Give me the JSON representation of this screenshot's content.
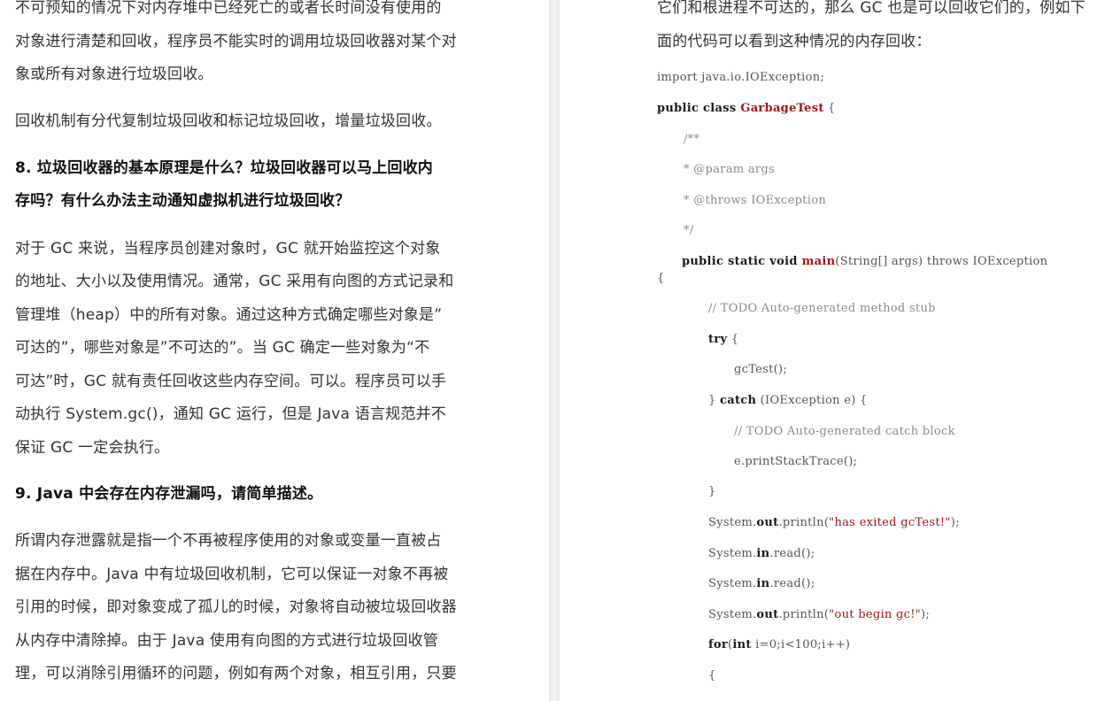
{
  "left_page": {
    "lines": [
      {
        "text": "不可预知的情况下对内存堆中已经死亡的或者长时间没有使用的",
        "style": "body"
      },
      {
        "text": "对象进行清楚和回收，程序员不能实时的调用垃圾回收器对某个对",
        "style": "body"
      },
      {
        "text": "象或所有对象进行垃圾回收。",
        "style": "body"
      },
      {
        "text": "回收机制有分代复制垃圾回收和标记垃圾回收，增量垃圾回收。",
        "style": "body"
      },
      {
        "text": "8.  垃圾回收器的基本原理是什么？垃圾回收器可以马上回收内",
        "style": "head"
      },
      {
        "text": "存吗？有什么办法主动通知虚拟机进行垃圾回收？",
        "style": "head"
      },
      {
        "text": "对于  GC  来说，当程序员创建对象时，GC  就开始监控这个对象",
        "style": "body"
      },
      {
        "text": "的地址、大小以及使用情况。通常，GC  采用有向图的方式记录和",
        "style": "body"
      },
      {
        "text": "管理堆（heap）中的所有对象。通过这种方式确定哪些对象是”",
        "style": "body"
      },
      {
        "text": "可达的”，哪些对象是”不可达的”。当  GC  确定一些对象为“不",
        "style": "body"
      },
      {
        "text": "可达”时，GC  就有责任回收这些内存空间。可以。程序员可以手",
        "style": "body"
      },
      {
        "text": "动执行  System.gc()，通知  GC  运行，但是  Java  语言规范并不",
        "style": "body"
      },
      {
        "text": "保证  GC  一定会执行。",
        "style": "body"
      },
      {
        "text": "9. Java  中会存在内存泄漏吗，请简单描述。",
        "style": "head"
      },
      {
        "text": "所谓内存泄露就是指一个不再被程序使用的对象或变量一直被占",
        "style": "body"
      },
      {
        "text": "据在内存中。Java  中有垃圾回收机制，它可以保证一对象不再被",
        "style": "body"
      },
      {
        "text": "引用的时候，即对象变成了孤儿的时候，对象将自动被垃圾回收器",
        "style": "body"
      },
      {
        "text": "从内存中清除掉。由于  Java  使用有向图的方式进行垃圾回收管",
        "style": "body"
      },
      {
        "text": "理，可以消除引用循环的问题，例如有两个对象，相互引用，只要",
        "style": "body"
      }
    ]
  },
  "right_page": {
    "intro": [
      "它们和根进程不可达的，那么  GC  也是可以回收它们的，例如下",
      "面的代码可以看到这种情况的内存回收："
    ],
    "code": [
      [
        {
          "t": "import java.io.IOException;",
          "c": ""
        }
      ],
      [
        {
          "t": "public class ",
          "c": "kw"
        },
        {
          "t": "GarbageTest",
          "c": "cls"
        },
        {
          "t": " {",
          "c": ""
        }
      ],
      [
        {
          "t": "/**",
          "c": "cm"
        }
      ],
      [
        {
          "t": " * @param args",
          "c": "cm"
        }
      ],
      [
        {
          "t": " * @throws IOException",
          "c": "cm"
        }
      ],
      [
        {
          "t": " */",
          "c": "cm"
        }
      ],
      [
        {
          "t": "public static void ",
          "c": "kw"
        },
        {
          "t": "main",
          "c": "cls"
        },
        {
          "t": "(String[] args) throws IOException",
          "c": ""
        }
      ],
      [
        {
          "t": "{",
          "c": ""
        }
      ],
      [
        {
          "t": "// TODO Auto-generated method stub",
          "c": "cm"
        }
      ],
      [
        {
          "t": "try",
          "c": "kw"
        },
        {
          "t": " {",
          "c": ""
        }
      ],
      [
        {
          "t": "gcTest();",
          "c": ""
        }
      ],
      [
        {
          "t": "} ",
          "c": ""
        },
        {
          "t": "catch",
          "c": "kw"
        },
        {
          "t": " (IOException e) {",
          "c": ""
        }
      ],
      [
        {
          "t": "// TODO Auto-generated catch block",
          "c": "cm"
        }
      ],
      [
        {
          "t": "e.printStackTrace();",
          "c": ""
        }
      ],
      [
        {
          "t": "}",
          "c": ""
        }
      ],
      [
        {
          "t": "System.",
          "c": ""
        },
        {
          "t": "out",
          "c": "kw"
        },
        {
          "t": ".println(",
          "c": ""
        },
        {
          "t": "\"has exited gcTest!\"",
          "c": "str"
        },
        {
          "t": ");",
          "c": ""
        }
      ],
      [
        {
          "t": "System.",
          "c": ""
        },
        {
          "t": "in",
          "c": "kw"
        },
        {
          "t": ".read();",
          "c": ""
        }
      ],
      [
        {
          "t": "System.",
          "c": ""
        },
        {
          "t": "in",
          "c": "kw"
        },
        {
          "t": ".read();",
          "c": ""
        }
      ],
      [
        {
          "t": "System.",
          "c": ""
        },
        {
          "t": "out",
          "c": "kw"
        },
        {
          "t": ".println(",
          "c": ""
        },
        {
          "t": "\"out begin gc!\"",
          "c": "str"
        },
        {
          "t": ");",
          "c": ""
        }
      ],
      [
        {
          "t": "for",
          "c": "kw"
        },
        {
          "t": "(",
          "c": ""
        },
        {
          "t": "int",
          "c": "kw"
        },
        {
          "t": " i=0;i<100;i++)",
          "c": ""
        }
      ],
      [
        {
          "t": "{",
          "c": ""
        }
      ]
    ]
  }
}
